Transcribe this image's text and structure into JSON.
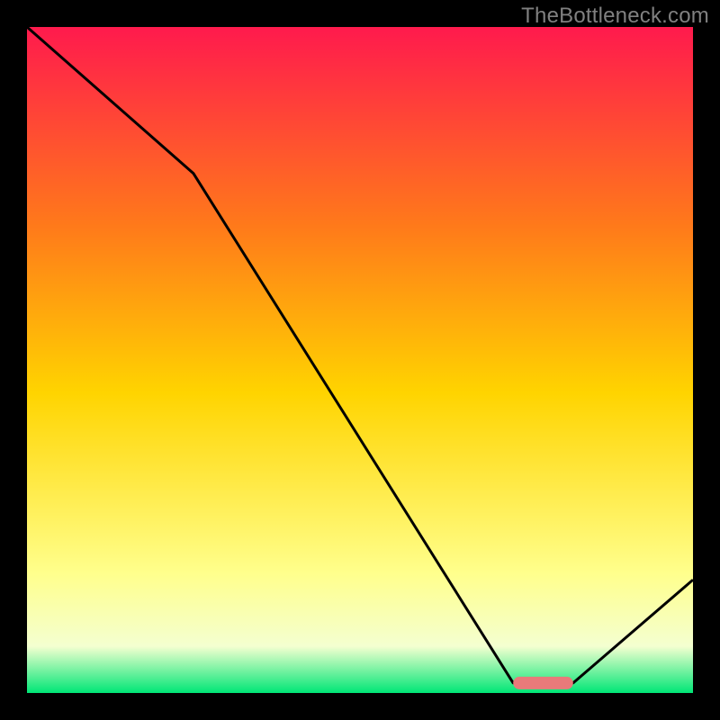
{
  "watermark": "TheBottleneck.com",
  "chart_data": {
    "type": "line",
    "title": "",
    "xlabel": "",
    "ylabel": "",
    "xlim": [
      0,
      100
    ],
    "ylim": [
      0,
      100
    ],
    "background_gradient": {
      "top": "#ff1a4d",
      "mid_upper": "#ff7a1a",
      "mid": "#ffd400",
      "mid_lower": "#ffff8c",
      "low": "#f4ffd0",
      "bottom": "#00e676"
    },
    "x": [
      0,
      25,
      73,
      82,
      100
    ],
    "values": [
      100,
      78,
      1.5,
      1.5,
      17
    ],
    "marker": {
      "x_start": 73,
      "x_end": 82,
      "y": 1.5,
      "color": "#e87a7a"
    }
  }
}
